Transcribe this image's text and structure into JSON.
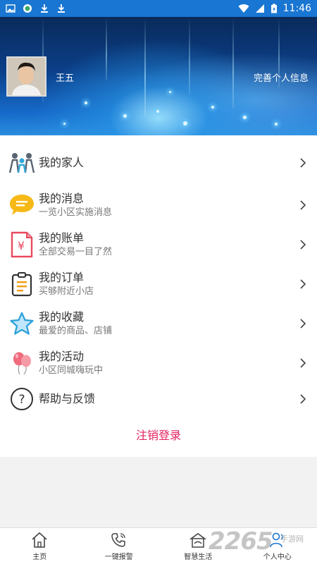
{
  "status_bar": {
    "time": "11:46"
  },
  "profile": {
    "name": "王五",
    "complete_info": "完善个人信息"
  },
  "menu": [
    {
      "title": "我的家人",
      "subtitle": "",
      "icon": "family-icon"
    },
    {
      "title": "我的消息",
      "subtitle": "一览小区实施消息",
      "icon": "message-icon"
    },
    {
      "title": "我的账单",
      "subtitle": "全部交易一目了然",
      "icon": "bill-icon"
    },
    {
      "title": "我的订单",
      "subtitle": "买够附近小店",
      "icon": "order-icon"
    },
    {
      "title": "我的收藏",
      "subtitle": "最爱的商品、店铺",
      "icon": "star-icon"
    },
    {
      "title": "我的活动",
      "subtitle": "小区同城嗨玩中",
      "icon": "balloon-icon"
    },
    {
      "title": "帮助与反馈",
      "subtitle": "",
      "icon": "help-icon"
    }
  ],
  "logout": "注销登录",
  "bottom_nav": [
    {
      "label": "主页",
      "icon": "home-icon"
    },
    {
      "label": "一键报警",
      "icon": "phone-icon"
    },
    {
      "label": "智慧生活",
      "icon": "smart-home-icon"
    },
    {
      "label": "个人中心",
      "icon": "person-icon",
      "active": true
    }
  ],
  "watermark": {
    "text": "2265",
    "sub": "手游网"
  },
  "colors": {
    "status_bar": "#1976d2",
    "logout": "#e5225f",
    "active_nav": "#1976d2"
  }
}
